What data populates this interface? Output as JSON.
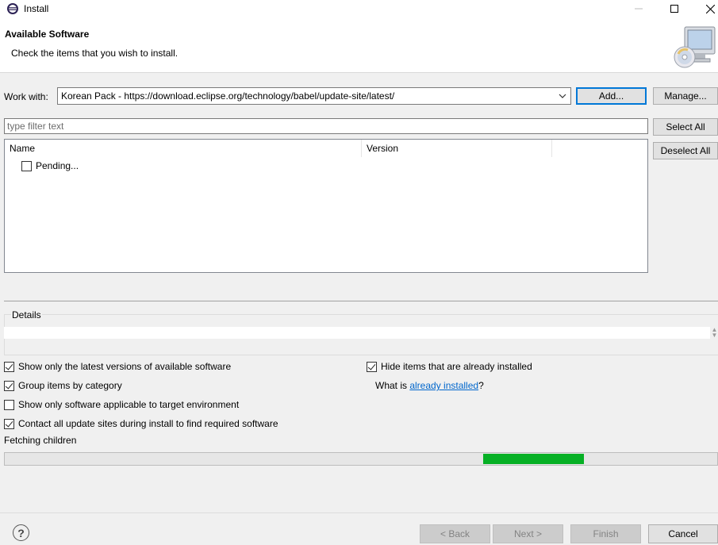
{
  "window": {
    "title": "Install",
    "minimize_glyph": "—",
    "maximize_glyph": "☐",
    "close_glyph": "✕"
  },
  "banner": {
    "title": "Available Software",
    "subtitle": "Check the items that you wish to install.",
    "icon": "install-software-cd-icon"
  },
  "work_with": {
    "label": "Work with:",
    "value": "Korean Pack - https://download.eclipse.org/technology/babel/update-site/latest/",
    "add_label": "Add...",
    "manage_label": "Manage..."
  },
  "filter": {
    "placeholder": "type filter text",
    "value": ""
  },
  "side_buttons": {
    "select_all": "Select All",
    "deselect_all": "Deselect All"
  },
  "table": {
    "columns": [
      "Name",
      "Version",
      ""
    ],
    "rows": [
      {
        "name": "Pending...",
        "version": "",
        "checked": false
      }
    ]
  },
  "details": {
    "label": "Details",
    "text": ""
  },
  "options": {
    "latest_versions": {
      "label": "Show only the latest versions of available software",
      "checked": true
    },
    "group_by_category": {
      "label": "Group items by category",
      "checked": true
    },
    "target_env": {
      "label": "Show only software applicable to target environment",
      "checked": false
    },
    "contact_sites": {
      "label": "Contact all update sites during install to find required software",
      "checked": true
    },
    "hide_installed": {
      "label": "Hide items that are already installed",
      "checked": true
    },
    "what_is_prefix": "What is ",
    "what_is_link": "already installed",
    "what_is_suffix": "?"
  },
  "status": {
    "text": "Fetching children",
    "progress_indeterminate": true,
    "progress_start_fraction": 0.672,
    "progress_width_fraction": 0.141
  },
  "footer": {
    "help_glyph": "?",
    "back_label": "< Back",
    "next_label": "Next >",
    "finish_label": "Finish",
    "cancel_label": "Cancel"
  },
  "colors": {
    "progress_fill": "#06b025",
    "link": "#0066cc",
    "default_button_border": "#0078d7"
  }
}
